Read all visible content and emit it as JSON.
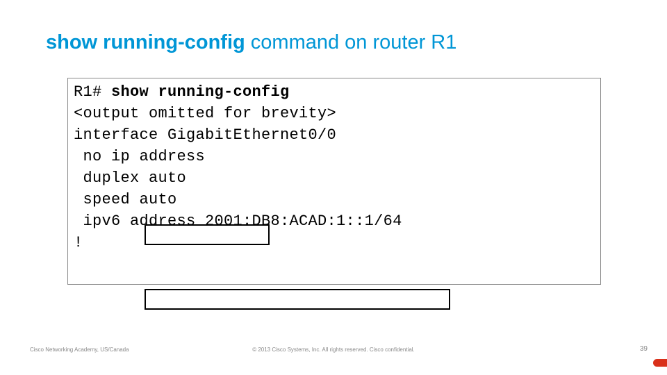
{
  "title": {
    "bold": "show running-config",
    "rest": " command on router R1"
  },
  "code": {
    "line1_prompt": "R1# ",
    "line1_cmd": "show running-config",
    "line2": "<output omitted for brevity>",
    "line3": "interface GigabitEthernet0/0",
    "line4": " no ip address",
    "line5": " duplex auto",
    "line6": " speed auto",
    "line7": " ipv6 address 2001:DB8:ACAD:1::1/64",
    "line8": "!"
  },
  "footer": {
    "left": "Cisco Networking Academy, US/Canada",
    "center": "© 2013 Cisco Systems, Inc. All rights reserved. Cisco confidential.",
    "page": "39"
  }
}
